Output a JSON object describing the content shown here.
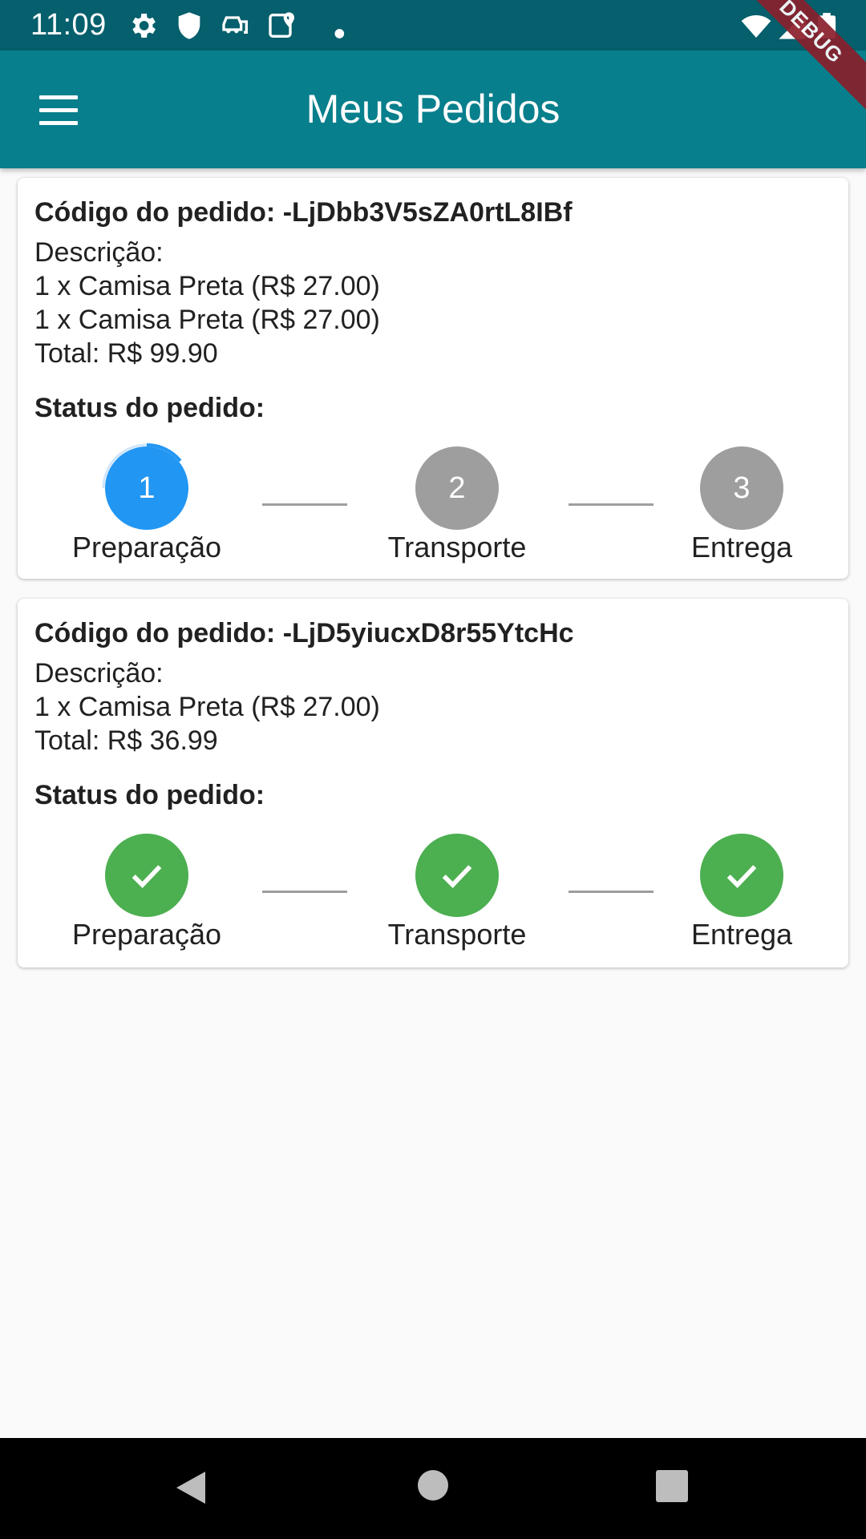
{
  "status_bar": {
    "time": "11:09",
    "icons": [
      "settings-icon",
      "shield-icon",
      "car-icon",
      "map-pin-icon",
      "dot-icon",
      "wifi-icon",
      "signal-icon",
      "battery-icon"
    ],
    "debug_label": "DEBUG"
  },
  "app_bar": {
    "title": "Meus Pedidos",
    "menu_icon": "menu-icon"
  },
  "orders": [
    {
      "code": "Código do pedido: -LjDbb3V5sZA0rtL8IBf",
      "description_label": "Descrição:",
      "items": [
        "1 x Camisa Preta (R$ 27.00)",
        "1 x Camisa Preta (R$ 27.00)"
      ],
      "total": "Total: R$ 99.90",
      "status_title": "Status do pedido:",
      "steps": [
        {
          "number": "1",
          "label": "Preparação",
          "state": "active"
        },
        {
          "number": "2",
          "label": "Transporte",
          "state": "pending"
        },
        {
          "number": "3",
          "label": "Entrega",
          "state": "pending"
        }
      ]
    },
    {
      "code": "Código do pedido: -LjD5yiucxD8r55YtcHc",
      "description_label": "Descrição:",
      "items": [
        "1 x Camisa Preta (R$ 27.00)"
      ],
      "total": "Total: R$ 36.99",
      "status_title": "Status do pedido:",
      "steps": [
        {
          "number": "",
          "label": "Preparação",
          "state": "done"
        },
        {
          "number": "",
          "label": "Transporte",
          "state": "done"
        },
        {
          "number": "",
          "label": "Entrega",
          "state": "done"
        }
      ]
    }
  ],
  "colors": {
    "status_bar": "#055f6c",
    "app_bar": "#087f8c",
    "step_active": "#2196f3",
    "step_pending": "#9e9e9e",
    "step_done": "#4caf50"
  },
  "nav_bar": {
    "icons": [
      "back-icon",
      "home-icon",
      "recents-icon"
    ]
  }
}
